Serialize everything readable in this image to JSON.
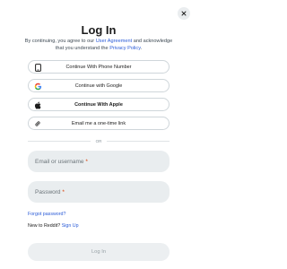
{
  "close_icon": "close-icon",
  "title": "Log In",
  "agreement": {
    "prefix": "By continuing, you agree to our ",
    "user_agreement_link": "User Agreement",
    "middle": " and acknowledge that you understand the ",
    "privacy_link": "Privacy Policy",
    "suffix": "."
  },
  "providers": [
    {
      "label": "Continue With Phone Number",
      "icon": "phone-icon"
    },
    {
      "label": "Continue with Google",
      "icon": "google-icon"
    },
    {
      "label": "Continue With Apple",
      "icon": "apple-icon"
    },
    {
      "label": "Email me a one-time link",
      "icon": "link-icon"
    }
  ],
  "divider_text": "OR",
  "fields": {
    "username_placeholder": "Email or username",
    "password_placeholder": "Password",
    "required_marker": "*"
  },
  "forgot_password": "Forgot password?",
  "new_to": {
    "text": "New to Reddit? ",
    "signup_link": "Sign Up"
  },
  "login_button": "Log In",
  "colors": {
    "link": "#2a5bd7",
    "required": "#d93a00",
    "field_bg": "#e9edef"
  }
}
